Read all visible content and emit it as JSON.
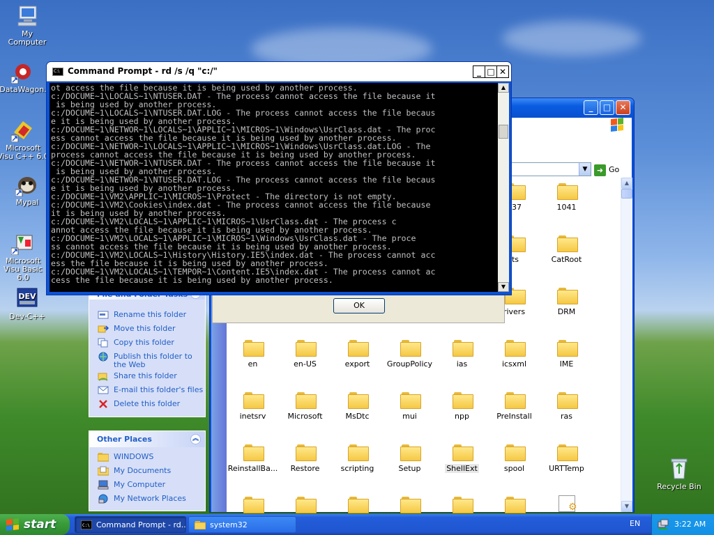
{
  "desktop": {
    "icons": [
      {
        "label": "My Computer",
        "icon": "my-computer-icon"
      },
      {
        "label": "DataWagon.",
        "icon": "datawagon-shortcut-icon"
      },
      {
        "label": "Microsoft Visu C++ 6.0",
        "icon": "visual-cpp-shortcut-icon"
      },
      {
        "label": "Mypal",
        "icon": "mypal-browser-icon"
      },
      {
        "label": "Microsoft Visu Basic 6.0",
        "icon": "visual-basic-shortcut-icon"
      },
      {
        "label": "Dev-C++",
        "icon": "dev-cpp-icon"
      },
      {
        "label": "Recycle Bin",
        "icon": "recycle-bin-icon"
      }
    ]
  },
  "cmd": {
    "title": "Command Prompt - rd /s /q \"c:/\"",
    "controls": {
      "minimize": "_",
      "maximize": "□",
      "close": "✕"
    },
    "lines": [
      "ot access the file because it is being used by another process.",
      "c:/DOCUME~1\\LOCALS~1\\NTUSER.DAT - The process cannot access the file because it",
      " is being used by another process.",
      "c:/DOCUME~1\\LOCALS~1\\NTUSER.DAT.LOG - The process cannot access the file becaus",
      "e it is being used by another process.",
      "c:/DOCUME~1\\NETWOR~1\\LOCALS~1\\APPLIC~1\\MICROS~1\\Windows\\UsrClass.dat - The proc",
      "ess cannot access the file because it is being used by another process.",
      "c:/DOCUME~1\\NETWOR~1\\LOCALS~1\\APPLIC~1\\MICROS~1\\Windows\\UsrClass.dat.LOG - The",
      "process cannot access the file because it is being used by another process.",
      "c:/DOCUME~1\\NETWOR~1\\NTUSER.DAT - The process cannot access the file because it",
      " is being used by another process.",
      "c:/DOCUME~1\\NETWOR~1\\NTUSER.DAT.LOG - The process cannot access the file becaus",
      "e it is being used by another process.",
      "c:/DOCUME~1\\VM2\\APPLIC~1\\MICROS~1\\Protect - The directory is not empty.",
      "c:/DOCUME~1\\VM2\\Cookies\\index.dat - The process cannot access the file because",
      "it is being used by another process.",
      "c:/DOCUME~1\\VM2\\LOCALS~1\\APPLIC~1\\MICROS~1\\UsrClass.dat - The process c",
      "annot access the file because it is being used by another process.",
      "c:/DOCUME~1\\VM2\\LOCALS~1\\APPLIC~1\\MICROS~1\\Windows\\UsrClass.dat - The proce",
      "ss cannot access the file because it is being used by another process.",
      "c:/DOCUME~1\\VM2\\LOCALS~1\\History\\History.IE5\\index.dat - The process cannot acc",
      "ess the file because it is being used by another process.",
      "c:/DOCUME~1\\VM2\\LOCALS~1\\TEMPOR~1\\Content.IE5\\index.dat - The process cannot ac",
      "cess the file because it is being used by another process."
    ]
  },
  "dialog": {
    "ok_label": "OK"
  },
  "explorer": {
    "go_label": "Go",
    "task_pane": {
      "folder_tasks_title": "File and Folder Tasks",
      "folder_tasks": [
        {
          "label": "Rename this folder",
          "icon": "rename-icon"
        },
        {
          "label": "Move this folder",
          "icon": "move-icon"
        },
        {
          "label": "Copy this folder",
          "icon": "copy-icon"
        },
        {
          "label": "Publish this folder to the Web",
          "icon": "publish-web-icon"
        },
        {
          "label": "Share this folder",
          "icon": "share-icon"
        },
        {
          "label": "E-mail this folder's files",
          "icon": "email-icon"
        },
        {
          "label": "Delete this folder",
          "icon": "delete-icon"
        }
      ],
      "other_places_title": "Other Places",
      "other_places": [
        {
          "label": "WINDOWS",
          "icon": "folder-icon"
        },
        {
          "label": "My Documents",
          "icon": "my-documents-icon"
        },
        {
          "label": "My Computer",
          "icon": "my-computer-icon"
        },
        {
          "label": "My Network Places",
          "icon": "network-places-icon"
        }
      ]
    },
    "folders_partial": [
      "037",
      "1041",
      "its",
      "CatRoot",
      "rivers",
      "DRM"
    ],
    "folders": [
      [
        "en",
        "en-US",
        "export",
        "GroupPolicy",
        "ias",
        "icsxml",
        "IME"
      ],
      [
        "inetsrv",
        "Microsoft",
        "MsDtc",
        "mui",
        "npp",
        "PreInstall",
        "ras"
      ],
      [
        "ReinstallBa...",
        "Restore",
        "scripting",
        "Setup",
        "ShellExt",
        "spool",
        "URTTemp"
      ]
    ]
  },
  "taskbar": {
    "start_label": "start",
    "buttons": [
      {
        "label": "Command Prompt - rd...",
        "icon": "cmd-icon",
        "active": true
      },
      {
        "label": "system32",
        "icon": "folder-icon",
        "active": false
      }
    ],
    "language": "EN",
    "clock": "3:22 AM"
  }
}
